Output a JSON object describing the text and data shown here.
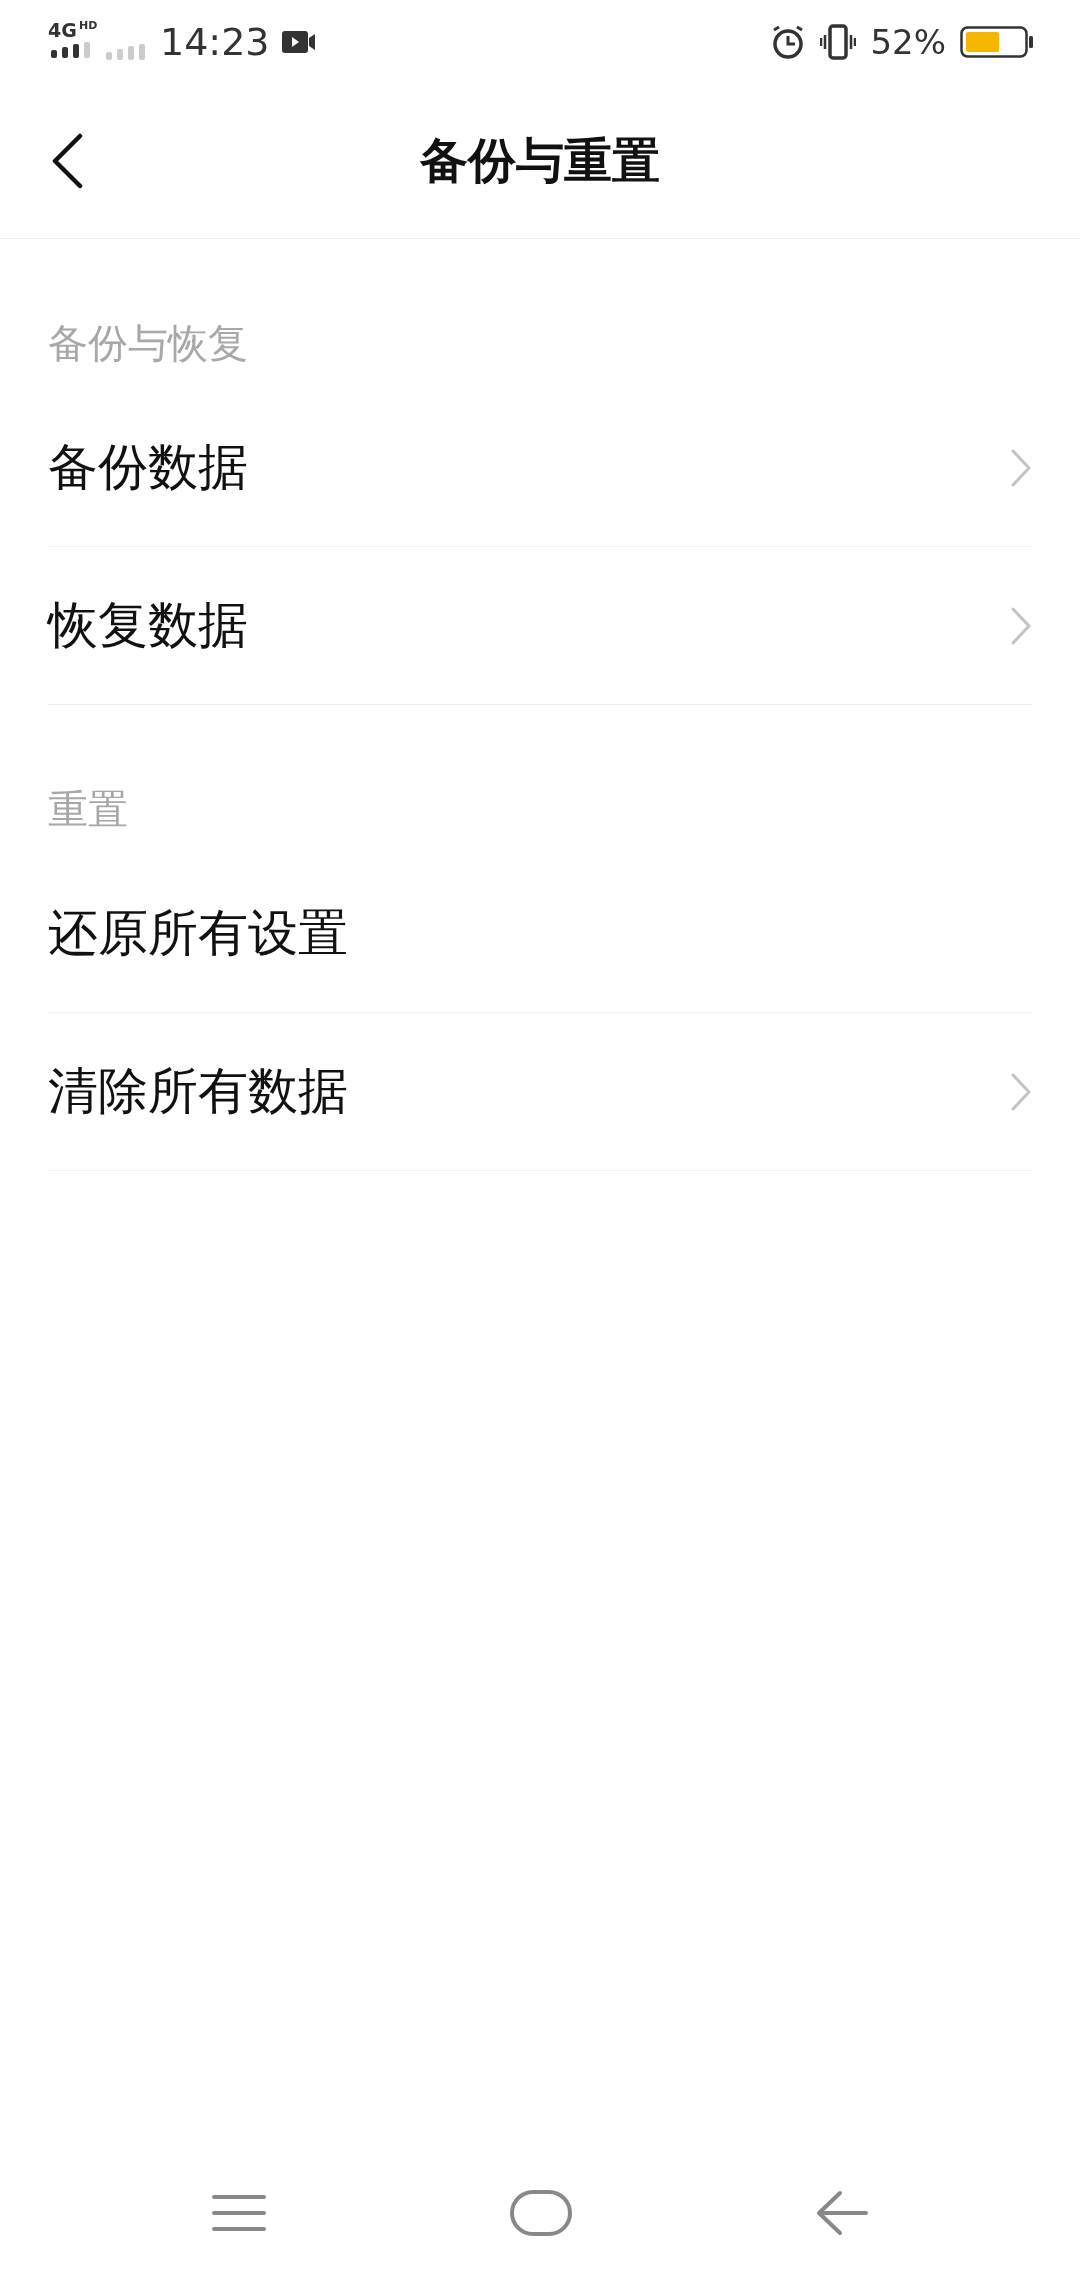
{
  "status_bar": {
    "network": "4G",
    "network_badge": "HD",
    "time": "14:23",
    "battery": "52%"
  },
  "header": {
    "title": "备份与重置"
  },
  "sections": [
    {
      "title": "备份与恢复",
      "items": [
        {
          "label": "备份数据",
          "chevron": true
        },
        {
          "label": "恢复数据",
          "chevron": true
        }
      ]
    },
    {
      "title": "重置",
      "items": [
        {
          "label": "还原所有设置",
          "chevron": false
        },
        {
          "label": "清除所有数据",
          "chevron": true
        }
      ]
    }
  ]
}
